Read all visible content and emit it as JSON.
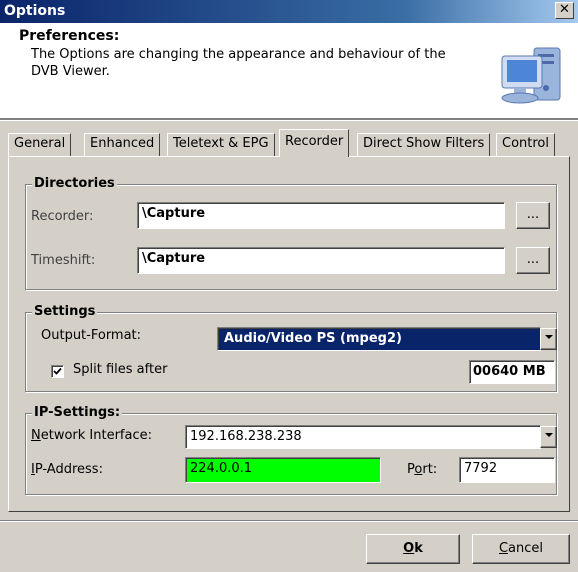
{
  "window": {
    "title": "Options",
    "close_glyph": "✕"
  },
  "header": {
    "title": "Preferences:",
    "description": "The Options are changing the appearance and behaviour of the DVB Viewer.",
    "icon": "computer-monitor-icon"
  },
  "tabs": [
    {
      "label": "General",
      "active": false
    },
    {
      "label": "Enhanced",
      "active": false
    },
    {
      "label": "Teletext & EPG",
      "active": false
    },
    {
      "label": "Recorder",
      "active": true
    },
    {
      "label": "Direct Show Filters",
      "active": false
    },
    {
      "label": "Control",
      "active": false
    }
  ],
  "directories": {
    "title": "Directories",
    "recorder_label": "Recorder:",
    "recorder_value": "\\Capture",
    "timeshift_label": "Timeshift:",
    "timeshift_value": "\\Capture",
    "browse_label": "..."
  },
  "settings": {
    "title": "Settings",
    "output_format_label": "Output-Format:",
    "output_format_value": "Audio/Video PS (mpeg2)",
    "split_label": "Split files after",
    "split_checked": true,
    "split_value": "00640 MB"
  },
  "ip_settings": {
    "title": "IP-Settings:",
    "network_interface_label_u": "N",
    "network_interface_label_rest": "etwork Interface:",
    "network_interface_value": "192.168.238.238",
    "ip_address_label_u": "I",
    "ip_address_label_rest": "P-Address:",
    "ip_address_value": "224.0.0.1",
    "ip_address_color": "#00ff00",
    "port_label_pre": "P",
    "port_label_u": "o",
    "port_label_rest": "rt:",
    "port_value": "7792"
  },
  "buttons": {
    "ok_u": "O",
    "ok_rest": "k",
    "cancel_u": "C",
    "cancel_rest": "ancel"
  }
}
